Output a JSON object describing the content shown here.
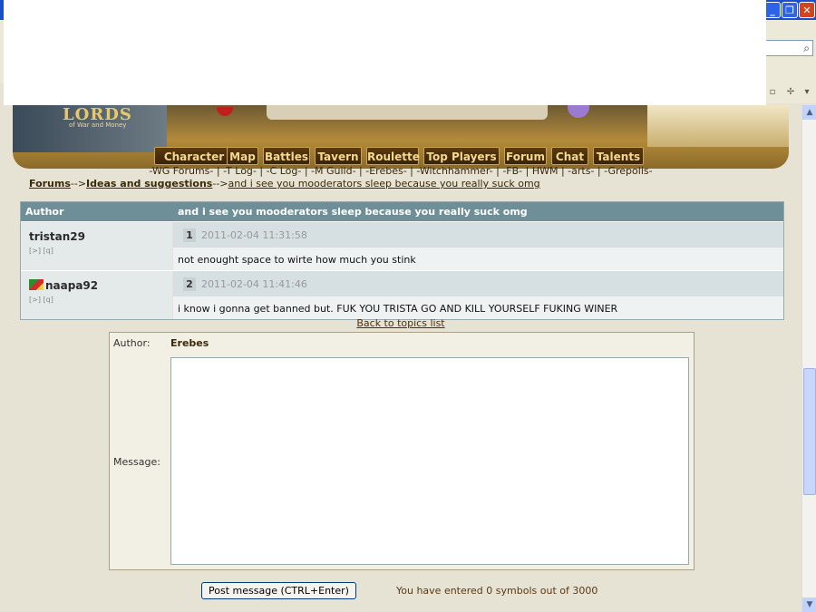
{
  "window": {
    "min_icon": "minimize-icon",
    "max_icon": "restore-icon",
    "close_icon": "close-icon",
    "min_glyph": "_",
    "max_glyph": "❐",
    "close_glyph": "✕"
  },
  "banner": {
    "logo": "LORDS",
    "logo_sub": "of War and Money"
  },
  "menu": [
    {
      "label": "Character"
    },
    {
      "label": "Map"
    },
    {
      "label": "Battles"
    },
    {
      "label": "Tavern"
    },
    {
      "label": "Roulette"
    },
    {
      "label": "Top Players"
    },
    {
      "label": "Forum"
    },
    {
      "label": "Chat"
    },
    {
      "label": "Talents"
    }
  ],
  "ext_links": "-WG Forums- | -T Log- | -C Log- | -M Guild- | -Erebes- | -Witchhammer- | -FB- | HWM | -arts- | -Grepolis-",
  "breadcrumb": {
    "forums": "Forums",
    "sep1": "-->",
    "section": "Ideas and suggestions",
    "sep2": "-->",
    "topic": "and i see you mooderators sleep because you really suck omg"
  },
  "table": {
    "col_author": "Author",
    "col_topic": "and i see you mooderators sleep because you really suck omg",
    "posts": [
      {
        "author": "tristan29",
        "mini": "[>] [q]",
        "num": "1",
        "date": "2011-02-04 11:31:58",
        "text": "not enought space to wirte how much you stink",
        "flag": false
      },
      {
        "author": "naapa92",
        "mini": "[>] [q]",
        "num": "2",
        "date": "2011-02-04 11:41:46",
        "text": "i know i gonna get banned but. FUK YOU TRISTA GO AND KILL YOURSELF FUKING WINER",
        "flag": true
      }
    ]
  },
  "back_link": "Back to topics list",
  "reply": {
    "author_label": "Author:",
    "author_value": "Erebes",
    "message_label": "Message:",
    "message_value": ""
  },
  "post_button": "Post message (CTRL+Enter)",
  "counter": "You have entered 0 symbols out of 3000",
  "icons": {
    "search": "search-icon",
    "scroll_up": "arrow-up-icon",
    "scroll_down": "arrow-down-icon"
  }
}
